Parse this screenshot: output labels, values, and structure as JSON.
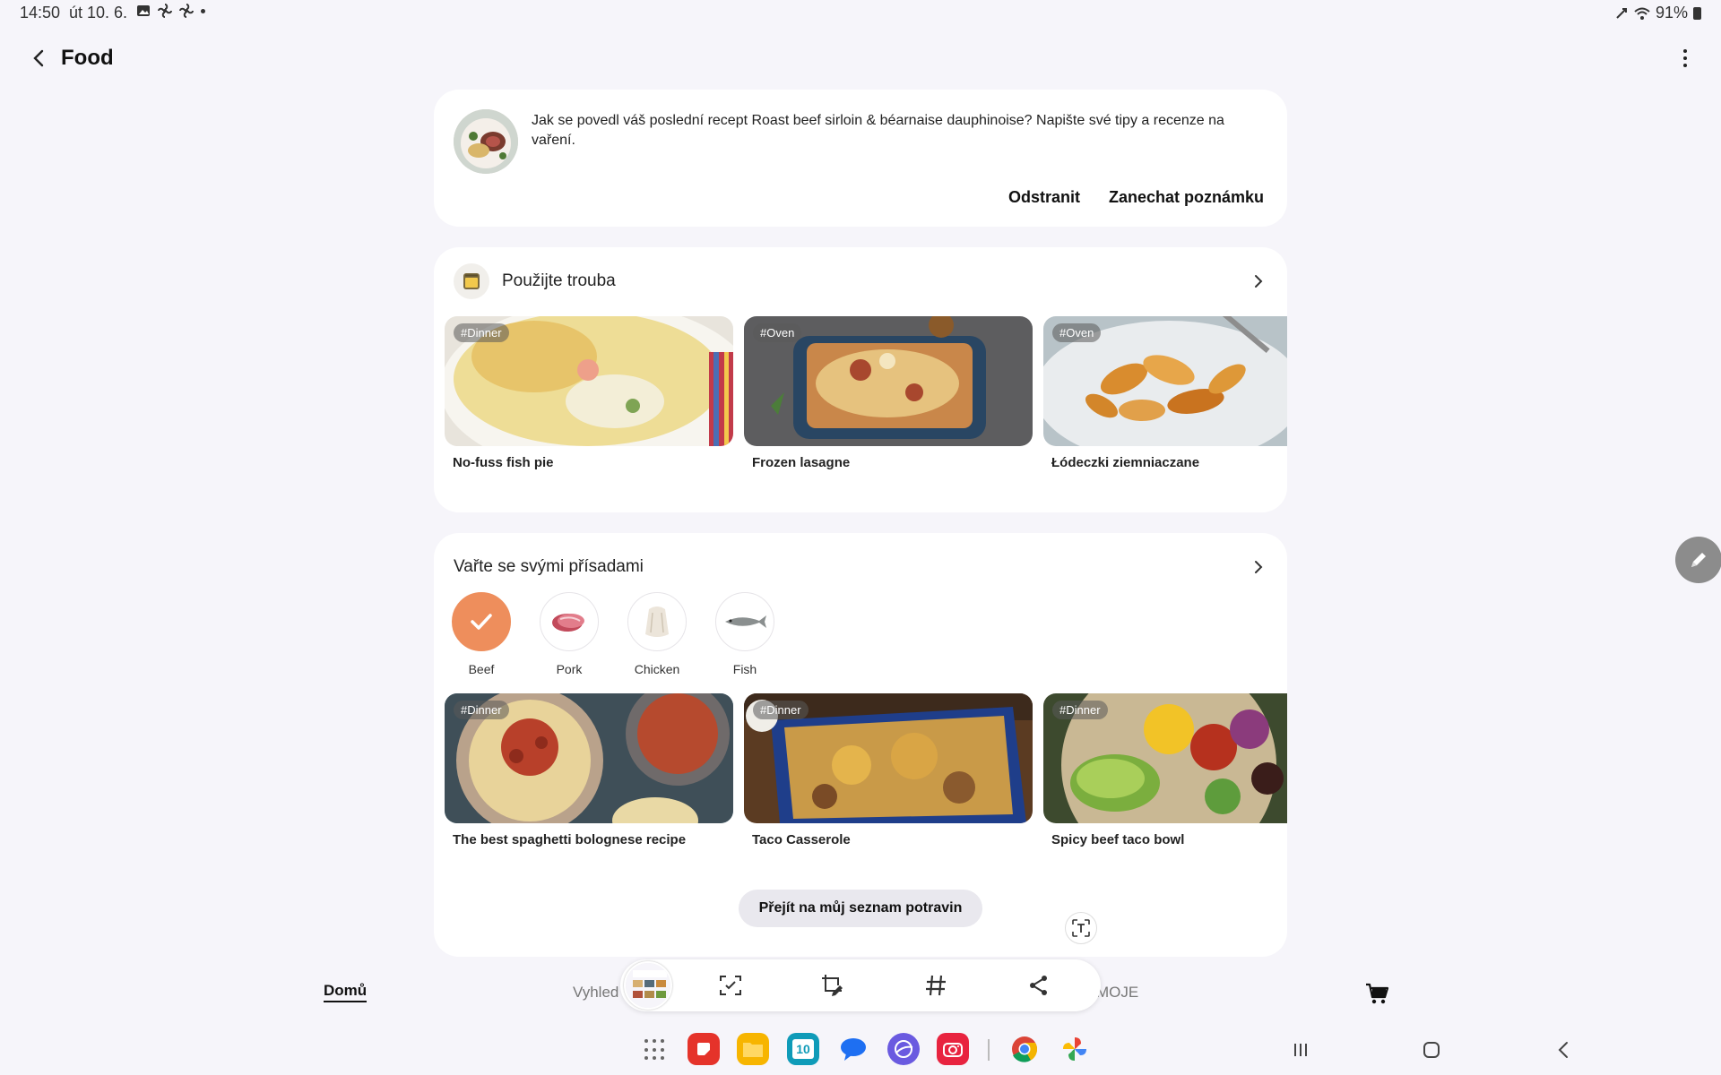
{
  "status_bar": {
    "time": "14:50",
    "date": "út 10. 6.",
    "battery": "91%"
  },
  "header": {
    "title": "Food"
  },
  "note_card": {
    "message": "Jak se povedl váš poslední recept Roast beef sirloin & béarnaise dauphinoise? Napište své tipy a recenze na vaření.",
    "remove_label": "Odstranit",
    "note_label": "Zanechat poznámku"
  },
  "oven_section": {
    "title": "Použijte trouba",
    "recipes": [
      {
        "tag": "#Dinner",
        "name": "No-fuss fish pie"
      },
      {
        "tag": "#Oven",
        "name": "Frozen lasagne"
      },
      {
        "tag": "#Oven",
        "name": "Łódeczki ziemniaczane"
      }
    ]
  },
  "ingredients_section": {
    "title": "Vařte se svými přísadami",
    "ingredients": [
      {
        "label": "Beef",
        "selected": true
      },
      {
        "label": "Pork",
        "selected": false
      },
      {
        "label": "Chicken",
        "selected": false
      },
      {
        "label": "Fish",
        "selected": false
      }
    ],
    "recipes": [
      {
        "tag": "#Dinner",
        "name": "The best spaghetti bolognese recipe"
      },
      {
        "tag": "#Dinner",
        "name": "Taco Casserole"
      },
      {
        "tag": "#Dinner",
        "name": "Spicy beef taco bowl"
      }
    ],
    "grocery_button": "Přejít na můj seznam potravin"
  },
  "bottom_nav": {
    "home": "Domů",
    "search": "Vyhled",
    "mine": "MOJE"
  },
  "capture_toolbar": {
    "icons": [
      "scan-icon",
      "crop-edit-icon",
      "hashtag-icon",
      "share-icon"
    ]
  },
  "dock": {
    "calendar_day": "10"
  },
  "colors": {
    "background": "#f6f5fa",
    "card": "#ffffff",
    "accent_selected": "#ee8e5c"
  }
}
